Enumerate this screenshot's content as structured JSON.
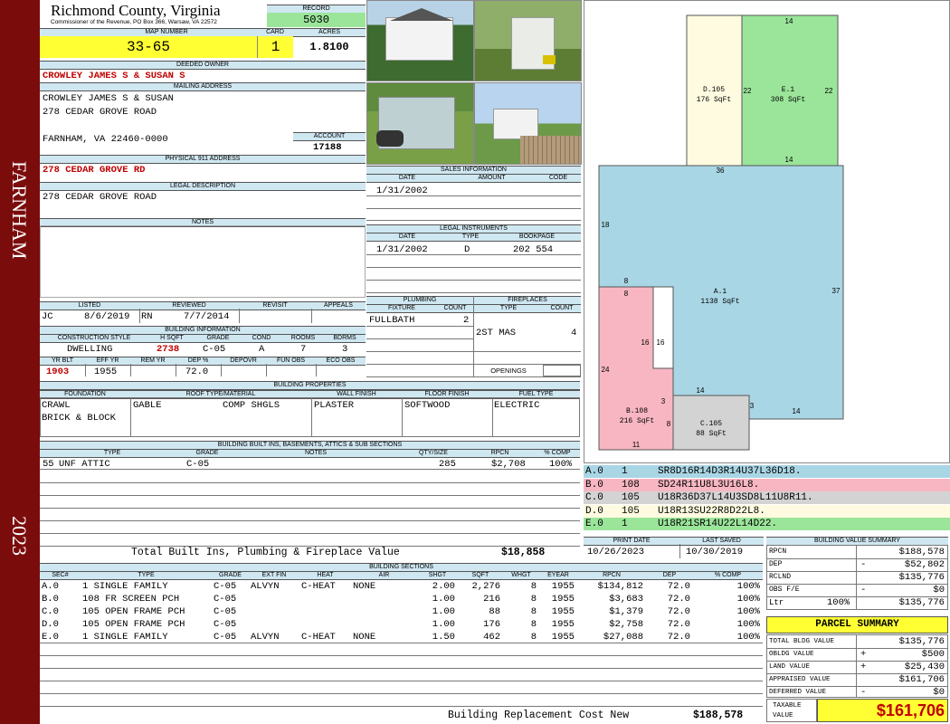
{
  "sidebar": {
    "town": "FARNHAM",
    "year": "2023"
  },
  "header": {
    "county": "Richmond County, Virginia",
    "commissioner": "Commissioner of the Revenue, PO Box 366, Warsaw, VA 22572",
    "record_label": "RECORD",
    "record": "5030",
    "map_label": "MAP NUMBER",
    "map": "33-65",
    "card_label": "CARD",
    "card": "1",
    "acres_label": "ACRES",
    "acres": "1.8100"
  },
  "owner": {
    "deeded_label": "DEEDED OWNER",
    "deeded": "CROWLEY JAMES S & SUSAN S",
    "mailing_label": "MAILING ADDRESS",
    "mail1": "CROWLEY JAMES S & SUSAN",
    "mail2": "278 CEDAR GROVE ROAD",
    "mail3": "FARNHAM, VA 22460-0000",
    "account_label": "ACCOUNT",
    "account": "17188",
    "phys_label": "PHYSICAL 911 ADDRESS",
    "phys": "278 CEDAR GROVE RD",
    "legal_label": "LEGAL DESCRIPTION",
    "legal": "278 CEDAR GROVE ROAD",
    "notes_label": "NOTES"
  },
  "sales": {
    "title": "SALES INFORMATION",
    "h_date": "DATE",
    "h_amount": "AMOUNT",
    "h_code": "CODE",
    "date": "1/31/2002"
  },
  "instruments": {
    "title": "LEGAL INSTRUMENTS",
    "h_date": "DATE",
    "h_type": "TYPE",
    "h_book": "BOOKPAGE",
    "date": "1/31/2002",
    "type": "D",
    "book": "202 554"
  },
  "review": {
    "h_listed": "LISTED",
    "h_reviewed": "REVIEWED",
    "h_revisit": "REVISIT",
    "h_appeals": "APPEALS",
    "listed_by": "JC",
    "listed": "8/6/2019",
    "reviewed_by": "RN",
    "reviewed": "7/7/2014"
  },
  "plumbing": {
    "title": "PLUMBING",
    "h_fixture": "FIXTURE",
    "h_count": "COUNT",
    "fixture": "FULLBATH",
    "count": "2"
  },
  "fireplaces": {
    "title": "FIREPLACES",
    "h_type": "TYPE",
    "h_count": "COUNT",
    "type": "2ST MAS",
    "count": "4",
    "openings": "OPENINGS"
  },
  "building_info": {
    "title": "BUILDING INFORMATION",
    "h_style": "CONSTRUCTION STYLE",
    "h_hsqft": "H SQFT",
    "h_grade": "GRADE",
    "h_cond": "COND",
    "h_rooms": "ROOMS",
    "h_bdrms": "BDRMS",
    "style": "DWELLING",
    "hsqft": "2738",
    "grade": "C-05",
    "cond": "A",
    "rooms": "7",
    "bdrms": "3",
    "h_yrblt": "YR BLT",
    "h_effyr": "EFF YR",
    "h_remyr": "REM YR",
    "h_dep": "DEP %",
    "h_depovr": "DEPOVR",
    "h_funobs": "FUN OBS",
    "h_ecoobs": "ECO OBS",
    "yrblt": "1903",
    "effyr": "1955",
    "dep": "72.0"
  },
  "properties": {
    "title": "BUILDING PROPERTIES",
    "h_found": "FOUNDATION",
    "h_roof": "ROOF TYPE/MATERIAL",
    "h_wall": "WALL FINISH",
    "h_floor": "FLOOR FINISH",
    "h_fuel": "FUEL TYPE",
    "found1": "CRAWL",
    "found2": "BRICK & BLOCK",
    "roof1": "GABLE",
    "roof2": "COMP SHGLS",
    "wall": "PLASTER",
    "floor": "SOFTWOOD",
    "fuel": "ELECTRIC"
  },
  "builtins": {
    "title": "BUILDING BUILT INS, BASEMENTS, ATTICS & SUB SECTIONS",
    "h_type": "TYPE",
    "h_grade": "GRADE",
    "h_notes": "NOTES",
    "h_qty": "QTY/SIZE",
    "h_rpcn": "RPCN",
    "h_comp": "% COMP",
    "r_code": "55",
    "r_type": "UNF ATTIC",
    "r_grade": "C-05",
    "r_qty": "285",
    "r_rpcn": "$2,708",
    "r_comp": "100%",
    "total_label": "Total Built Ins, Plumbing & Fireplace Value",
    "total": "$18,858"
  },
  "sketch_legend": [
    {
      "sec": "A.0",
      "code": "1",
      "path": "SR8D16R14D3R14U37L36D18.",
      "color": "#a9d6e5"
    },
    {
      "sec": "B.0",
      "code": "108",
      "path": "SD24R11U8L3U16L8.",
      "color": "#f7b6c2"
    },
    {
      "sec": "C.0",
      "code": "105",
      "path": "U18R36D37L14U3SD8L11U8R11.",
      "color": "#d3d3d3"
    },
    {
      "sec": "D.0",
      "code": "105",
      "path": "U18R13SU22R8D22L8.",
      "color": "#fffbe0"
    },
    {
      "sec": "E.0",
      "code": "1",
      "path": "U18R21SR14U22L14D22.",
      "color": "#9be59b"
    }
  ],
  "sketch": {
    "a_name": "A.1",
    "a_area": "1138 SqFt",
    "b_name": "B.108",
    "b_area": "216 SqFt",
    "c_name": "C.105",
    "c_area": "88 SqFt",
    "d_name": "D.105",
    "d_area": "176 SqFt",
    "e_name": "E.1",
    "e_area": "308 SqFt",
    "d14": "14",
    "d22a": "22",
    "d22b": "22",
    "d14b": "14",
    "d36": "36",
    "d18": "18",
    "d37": "37",
    "d8a": "8",
    "d8b": "8",
    "d16a": "16",
    "d16b": "16",
    "d24": "24",
    "d14c": "14",
    "d3a": "3",
    "d3b": "3",
    "d14d": "14",
    "d8c": "8",
    "d11": "11"
  },
  "dates": {
    "h_print": "PRINT DATE",
    "h_saved": "LAST SAVED",
    "print": "10/26/2023",
    "saved": "10/30/2019"
  },
  "value_summary": {
    "title": "BUILDING VALUE SUMMARY",
    "rpcn_l": "RPCN",
    "rpcn": "$188,578",
    "dep_l": "DEP",
    "dep_s": "-",
    "dep": "$52,802",
    "rclnd_l": "RCLND",
    "rclnd": "$135,776",
    "obs_l": "OBS F/E",
    "obs_s": "-",
    "obs": "$0",
    "ltr_l": "Ltr",
    "ltr_p": "100%",
    "ltr": "$135,776"
  },
  "parcel": {
    "title": "PARCEL SUMMARY",
    "bldg_l": "TOTAL BLDG VALUE",
    "bldg": "$135,776",
    "obldg_l": "OBLDG VALUE",
    "obldg_s": "+",
    "obldg": "$500",
    "land_l": "LAND VALUE",
    "land_s": "+",
    "land": "$25,430",
    "appr_l": "APPRAISED VALUE",
    "appr": "$161,706",
    "def_l": "DEFERRED VALUE",
    "def_s": "-",
    "def": "$0",
    "tax_l1": "TAXABLE",
    "tax_l2": "VALUE",
    "tax": "$161,706"
  },
  "sections": {
    "title": "BUILDING SECTIONS",
    "headers": [
      "SEC#",
      "TYPE",
      "GRADE",
      "EXT FIN",
      "HEAT",
      "AIR",
      "SHGT",
      "SQFT",
      "WHGT",
      "EYEAR",
      "RPCN",
      "DEP",
      "% COMP"
    ],
    "rows": [
      [
        "A.0",
        "1 SINGLE FAMILY",
        "C-05",
        "ALVYN",
        "C-HEAT",
        "NONE",
        "2.00",
        "2,276",
        "8",
        "1955",
        "$134,812",
        "72.0",
        "100%"
      ],
      [
        "B.0",
        "108 FR SCREEN PCH",
        "C-05",
        "",
        "",
        "",
        "1.00",
        "216",
        "8",
        "1955",
        "$3,683",
        "72.0",
        "100%"
      ],
      [
        "C.0",
        "105 OPEN FRAME PCH",
        "C-05",
        "",
        "",
        "",
        "1.00",
        "88",
        "8",
        "1955",
        "$1,379",
        "72.0",
        "100%"
      ],
      [
        "D.0",
        "105 OPEN FRAME PCH",
        "C-05",
        "",
        "",
        "",
        "1.00",
        "176",
        "8",
        "1955",
        "$2,758",
        "72.0",
        "100%"
      ],
      [
        "E.0",
        "1 SINGLE FAMILY",
        "C-05",
        "ALVYN",
        "C-HEAT",
        "NONE",
        "1.50",
        "462",
        "8",
        "1955",
        "$27,088",
        "72.0",
        "100%"
      ]
    ],
    "total_label": "Building Replacement Cost New",
    "total": "$188,578"
  }
}
